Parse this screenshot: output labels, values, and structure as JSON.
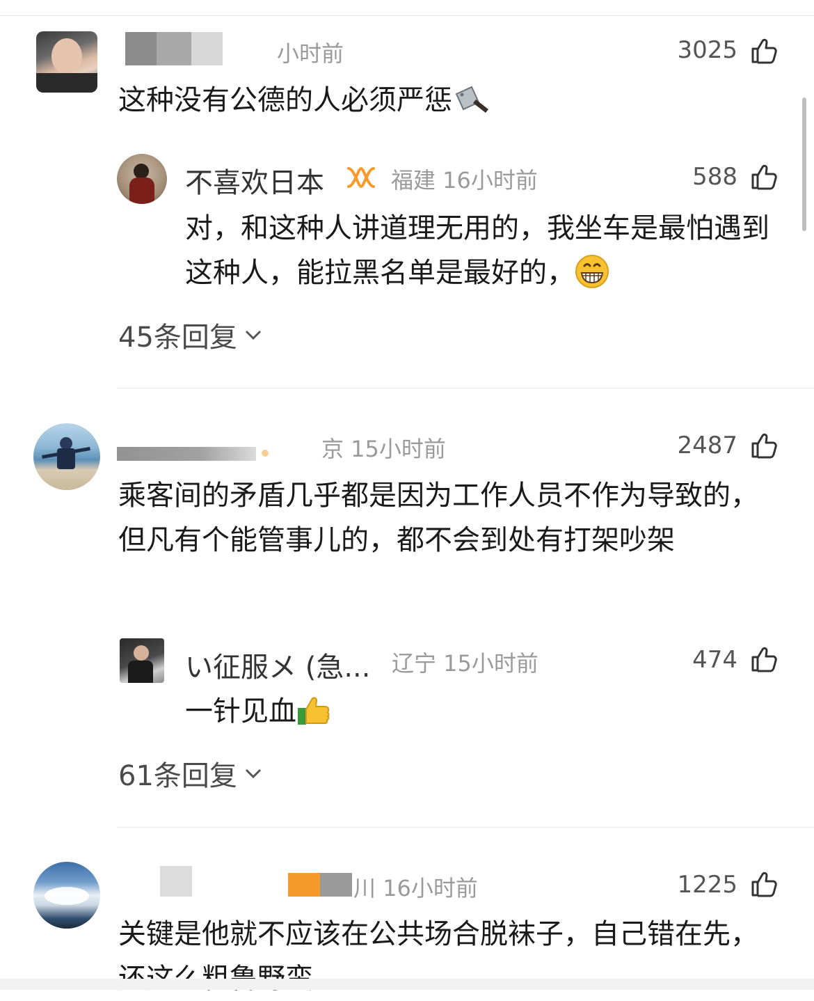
{
  "comments": [
    {
      "time": "小时前",
      "likes": "3025",
      "text": "这种没有公德的人必须严惩",
      "text_emoji": "cleaver-emoji",
      "reply": {
        "name": "不喜欢日本",
        "location_time": "福建 16小时前",
        "likes": "588",
        "text": "对，和这种人讲道理无用的，我坐车是最怕遇到这种人，能拉黑名单是最好的，",
        "text_emoji": "grinning-emoji"
      },
      "replies_count": "45条回复"
    },
    {
      "location_time": "京 15小时前",
      "likes": "2487",
      "text": "乘客间的矛盾几乎都是因为工作人员不作为导致的，但凡有个能管事儿的，都不会到处有打架吵架",
      "reply": {
        "name": "い征服メ (急...",
        "location_time": "辽宁 15小时前",
        "likes": "474",
        "text": "一针见血",
        "text_emoji": "thumbs-up-emoji"
      },
      "replies_count": "61条回复"
    },
    {
      "location_time": "川 16小时前",
      "likes": "1225",
      "text": "关键是他就不应该在公共场合脱袜子，自己错在先，还这么粗鲁野蛮"
    }
  ],
  "colors": {
    "accent_orange": "#f59a2b",
    "meta_gray": "#9a9a9a"
  }
}
